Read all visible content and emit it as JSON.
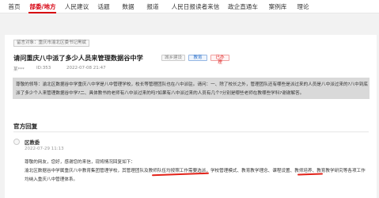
{
  "nav": {
    "items": [
      "首页",
      "部委/地方",
      "人民建议",
      "话题",
      "数据",
      "报道",
      "人民日报读者来信",
      "政企直通车",
      "案例库",
      "理论"
    ],
    "active_index": 1
  },
  "message": {
    "recipient": "留言对象：重庆市渝北区委书记黑斌",
    "title": "请问重庆八中派了多少人员来管理数据谷中学",
    "tags": [
      "城乡建设",
      "教育",
      "已办理"
    ],
    "author": "某***",
    "id": "ID:353",
    "date": "2022-07-08 21:47",
    "content_lines": [
      "尊敬的领导：渝北区数据谷中学重庆八中学是八中管理学校，校长等管理团队也在八中派驻。请问：一、除了校长之外，管理团队还有哪些是派过来的人员是八中派过来的?八中到底",
      "派了多少个人来管理数据谷中学?二、具体教书的老师有八中派过来的吗?如果有八中派过来的人员有几个?分别是哪些老师在教哪些学科?谢谢解答。"
    ]
  },
  "reply": {
    "section_title": "官方回复",
    "org": "区教委",
    "date": "2022-07-29 11:13",
    "lines": [
      "尊敬的网友，您好，感谢您的来信，现将情况回复如下：",
      "渝北区数据谷中学属重庆八中教育集团管理学校，其管理团队及教师队伍均按照工作需要选派，学校管理模式、教育教学理念、课程设置、教师培养、教育教学研究等各项工作",
      "均纳入重庆八中管理体系。"
    ]
  },
  "colors": {
    "accent": "#d6000f",
    "highlight": "#d9d9d9",
    "annotation": "#e2231a"
  }
}
